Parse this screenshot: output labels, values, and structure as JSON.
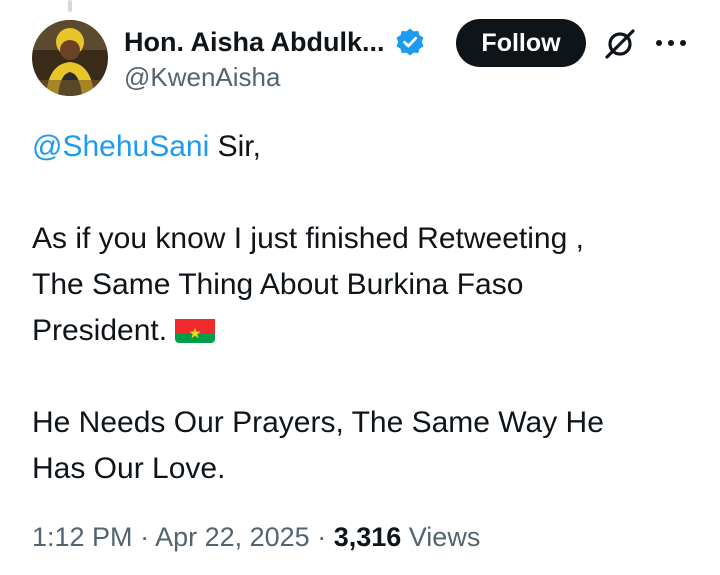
{
  "author": {
    "display_name": "Hon. Aisha Abdulk...",
    "handle": "@KwenAisha",
    "verified_icon": "verified-badge-icon",
    "avatar_icon": "profile-avatar"
  },
  "header": {
    "follow_label": "Follow",
    "grok_icon": "grok-icon",
    "more_icon": "more-options-icon"
  },
  "tweet": {
    "mention": "@ShehuSani",
    "greeting_rest": " Sir,",
    "para2_line1": "As if you know I just finished Retweeting ,",
    "para2_line2": "The Same Thing About Burkina Faso",
    "para2_line3": "President.",
    "flag_icon": "burkina-faso-flag-icon",
    "para3_line1": "He Needs Our Prayers, The Same Way He",
    "para3_line2": "Has Our Love."
  },
  "meta": {
    "time": "1:12 PM",
    "sep1": " · ",
    "date": "Apr 22, 2025",
    "sep2": " · ",
    "views_count": "3,316",
    "views_label": " Views"
  },
  "colors": {
    "accent": "#1d9bf0",
    "text": "#0f1419",
    "secondary": "#536471",
    "button": "#0f1419"
  }
}
